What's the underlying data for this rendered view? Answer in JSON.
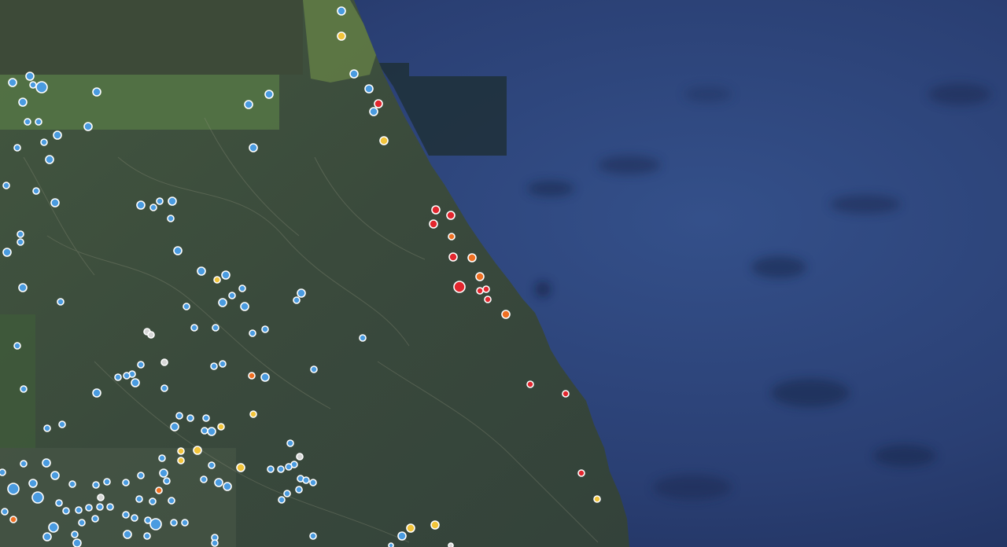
{
  "map": {
    "view": "satellite",
    "layer_colors": {
      "sea": "#2a3f73",
      "sea_deep": "#1d2c56",
      "land": "#3a4a3a",
      "land_light": "#6f8a50",
      "coast_dark": "#1e2c35"
    },
    "category_colors": {
      "blue": "#4a9be0",
      "yellow": "#f2c43a",
      "orange": "#ef6f22",
      "red": "#e2262e",
      "white": "#d6d6d6"
    },
    "markers": [
      {
        "lon": 434,
        "lat": 14,
        "c": "blue",
        "r": 5
      },
      {
        "lon": 434,
        "lat": 46,
        "c": "yellow",
        "r": 5
      },
      {
        "lon": 450,
        "lat": 94,
        "c": "blue",
        "r": 5
      },
      {
        "lon": 469,
        "lat": 113,
        "c": "blue",
        "r": 5
      },
      {
        "lon": 481,
        "lat": 132,
        "c": "red",
        "r": 5
      },
      {
        "lon": 475,
        "lat": 142,
        "c": "blue",
        "r": 5
      },
      {
        "lon": 488,
        "lat": 179,
        "c": "yellow",
        "r": 5
      },
      {
        "lon": 16,
        "lat": 105,
        "c": "blue",
        "r": 5
      },
      {
        "lon": 38,
        "lat": 97,
        "c": "blue",
        "r": 5
      },
      {
        "lon": 42,
        "lat": 108,
        "c": "blue",
        "r": 4
      },
      {
        "lon": 53,
        "lat": 111,
        "c": "blue",
        "r": 7
      },
      {
        "lon": 29,
        "lat": 130,
        "c": "blue",
        "r": 5
      },
      {
        "lon": 35,
        "lat": 155,
        "c": "blue",
        "r": 4
      },
      {
        "lon": 49,
        "lat": 155,
        "c": "blue",
        "r": 4
      },
      {
        "lon": 112,
        "lat": 161,
        "c": "blue",
        "r": 5
      },
      {
        "lon": 123,
        "lat": 117,
        "c": "blue",
        "r": 5
      },
      {
        "lon": 73,
        "lat": 172,
        "c": "blue",
        "r": 5
      },
      {
        "lon": 56,
        "lat": 181,
        "c": "blue",
        "r": 4
      },
      {
        "lon": 22,
        "lat": 188,
        "c": "blue",
        "r": 4
      },
      {
        "lon": 63,
        "lat": 203,
        "c": "blue",
        "r": 5
      },
      {
        "lon": 316,
        "lat": 133,
        "c": "blue",
        "r": 5
      },
      {
        "lon": 342,
        "lat": 120,
        "c": "blue",
        "r": 5
      },
      {
        "lon": 322,
        "lat": 188,
        "c": "blue",
        "r": 5
      },
      {
        "lon": 8,
        "lat": 236,
        "c": "blue",
        "r": 4
      },
      {
        "lon": 46,
        "lat": 243,
        "c": "blue",
        "r": 4
      },
      {
        "lon": 70,
        "lat": 258,
        "c": "blue",
        "r": 5
      },
      {
        "lon": 179,
        "lat": 261,
        "c": "blue",
        "r": 5
      },
      {
        "lon": 195,
        "lat": 264,
        "c": "blue",
        "r": 4
      },
      {
        "lon": 203,
        "lat": 256,
        "c": "blue",
        "r": 4
      },
      {
        "lon": 219,
        "lat": 256,
        "c": "blue",
        "r": 5
      },
      {
        "lon": 217,
        "lat": 278,
        "c": "blue",
        "r": 4
      },
      {
        "lon": 26,
        "lat": 298,
        "c": "blue",
        "r": 4
      },
      {
        "lon": 26,
        "lat": 308,
        "c": "blue",
        "r": 4
      },
      {
        "lon": 9,
        "lat": 321,
        "c": "blue",
        "r": 5
      },
      {
        "lon": 226,
        "lat": 319,
        "c": "blue",
        "r": 5
      },
      {
        "lon": 256,
        "lat": 345,
        "c": "blue",
        "r": 5
      },
      {
        "lon": 287,
        "lat": 350,
        "c": "blue",
        "r": 5
      },
      {
        "lon": 276,
        "lat": 356,
        "c": "yellow",
        "r": 4
      },
      {
        "lon": 308,
        "lat": 367,
        "c": "blue",
        "r": 4
      },
      {
        "lon": 29,
        "lat": 366,
        "c": "blue",
        "r": 5
      },
      {
        "lon": 383,
        "lat": 373,
        "c": "blue",
        "r": 5
      },
      {
        "lon": 377,
        "lat": 382,
        "c": "blue",
        "r": 4
      },
      {
        "lon": 295,
        "lat": 376,
        "c": "blue",
        "r": 4
      },
      {
        "lon": 283,
        "lat": 385,
        "c": "blue",
        "r": 5
      },
      {
        "lon": 311,
        "lat": 390,
        "c": "blue",
        "r": 5
      },
      {
        "lon": 237,
        "lat": 390,
        "c": "blue",
        "r": 4
      },
      {
        "lon": 77,
        "lat": 384,
        "c": "blue",
        "r": 4
      },
      {
        "lon": 247,
        "lat": 417,
        "c": "blue",
        "r": 4
      },
      {
        "lon": 274,
        "lat": 417,
        "c": "blue",
        "r": 4
      },
      {
        "lon": 337,
        "lat": 419,
        "c": "blue",
        "r": 4
      },
      {
        "lon": 321,
        "lat": 424,
        "c": "blue",
        "r": 4
      },
      {
        "lon": 187,
        "lat": 422,
        "c": "white",
        "r": 4
      },
      {
        "lon": 192,
        "lat": 426,
        "c": "white",
        "r": 4
      },
      {
        "lon": 461,
        "lat": 430,
        "c": "blue",
        "r": 4
      },
      {
        "lon": 22,
        "lat": 440,
        "c": "blue",
        "r": 4
      },
      {
        "lon": 209,
        "lat": 461,
        "c": "white",
        "r": 4
      },
      {
        "lon": 179,
        "lat": 464,
        "c": "blue",
        "r": 4
      },
      {
        "lon": 283,
        "lat": 463,
        "c": "blue",
        "r": 4
      },
      {
        "lon": 272,
        "lat": 466,
        "c": "blue",
        "r": 4
      },
      {
        "lon": 399,
        "lat": 470,
        "c": "blue",
        "r": 4
      },
      {
        "lon": 168,
        "lat": 476,
        "c": "blue",
        "r": 4
      },
      {
        "lon": 150,
        "lat": 480,
        "c": "blue",
        "r": 4
      },
      {
        "lon": 161,
        "lat": 478,
        "c": "blue",
        "r": 4
      },
      {
        "lon": 172,
        "lat": 487,
        "c": "blue",
        "r": 5
      },
      {
        "lon": 320,
        "lat": 478,
        "c": "orange",
        "r": 4
      },
      {
        "lon": 337,
        "lat": 480,
        "c": "blue",
        "r": 5
      },
      {
        "lon": 209,
        "lat": 494,
        "c": "blue",
        "r": 4
      },
      {
        "lon": 30,
        "lat": 495,
        "c": "blue",
        "r": 4
      },
      {
        "lon": 123,
        "lat": 500,
        "c": "blue",
        "r": 5
      },
      {
        "lon": 322,
        "lat": 527,
        "c": "yellow",
        "r": 4
      },
      {
        "lon": 228,
        "lat": 529,
        "c": "blue",
        "r": 4
      },
      {
        "lon": 242,
        "lat": 532,
        "c": "blue",
        "r": 4
      },
      {
        "lon": 262,
        "lat": 532,
        "c": "blue",
        "r": 4
      },
      {
        "lon": 222,
        "lat": 543,
        "c": "blue",
        "r": 5
      },
      {
        "lon": 281,
        "lat": 543,
        "c": "yellow",
        "r": 4
      },
      {
        "lon": 260,
        "lat": 548,
        "c": "blue",
        "r": 4
      },
      {
        "lon": 269,
        "lat": 549,
        "c": "blue",
        "r": 5
      },
      {
        "lon": 79,
        "lat": 540,
        "c": "blue",
        "r": 4
      },
      {
        "lon": 60,
        "lat": 545,
        "c": "blue",
        "r": 4
      },
      {
        "lon": 369,
        "lat": 564,
        "c": "blue",
        "r": 4
      },
      {
        "lon": 230,
        "lat": 574,
        "c": "yellow",
        "r": 4
      },
      {
        "lon": 251,
        "lat": 573,
        "c": "yellow",
        "r": 5
      },
      {
        "lon": 230,
        "lat": 586,
        "c": "yellow",
        "r": 4
      },
      {
        "lon": 206,
        "lat": 583,
        "c": "blue",
        "r": 4
      },
      {
        "lon": 381,
        "lat": 581,
        "c": "white",
        "r": 4
      },
      {
        "lon": 374,
        "lat": 591,
        "c": "blue",
        "r": 4
      },
      {
        "lon": 269,
        "lat": 592,
        "c": "blue",
        "r": 4
      },
      {
        "lon": 306,
        "lat": 595,
        "c": "yellow",
        "r": 5
      },
      {
        "lon": 344,
        "lat": 597,
        "c": "blue",
        "r": 4
      },
      {
        "lon": 357,
        "lat": 597,
        "c": "blue",
        "r": 4
      },
      {
        "lon": 367,
        "lat": 594,
        "c": "blue",
        "r": 4
      },
      {
        "lon": 30,
        "lat": 590,
        "c": "blue",
        "r": 4
      },
      {
        "lon": 59,
        "lat": 589,
        "c": "blue",
        "r": 5
      },
      {
        "lon": 3,
        "lat": 601,
        "c": "blue",
        "r": 4
      },
      {
        "lon": 70,
        "lat": 605,
        "c": "blue",
        "r": 5
      },
      {
        "lon": 179,
        "lat": 605,
        "c": "blue",
        "r": 4
      },
      {
        "lon": 208,
        "lat": 602,
        "c": "blue",
        "r": 5
      },
      {
        "lon": 212,
        "lat": 612,
        "c": "blue",
        "r": 4
      },
      {
        "lon": 160,
        "lat": 614,
        "c": "blue",
        "r": 4
      },
      {
        "lon": 136,
        "lat": 613,
        "c": "blue",
        "r": 4
      },
      {
        "lon": 122,
        "lat": 617,
        "c": "blue",
        "r": 4
      },
      {
        "lon": 259,
        "lat": 610,
        "c": "blue",
        "r": 4
      },
      {
        "lon": 278,
        "lat": 614,
        "c": "blue",
        "r": 5
      },
      {
        "lon": 289,
        "lat": 619,
        "c": "blue",
        "r": 5
      },
      {
        "lon": 382,
        "lat": 609,
        "c": "blue",
        "r": 4
      },
      {
        "lon": 389,
        "lat": 611,
        "c": "blue",
        "r": 4
      },
      {
        "lon": 398,
        "lat": 614,
        "c": "blue",
        "r": 4
      },
      {
        "lon": 380,
        "lat": 623,
        "c": "blue",
        "r": 4
      },
      {
        "lon": 365,
        "lat": 628,
        "c": "blue",
        "r": 4
      },
      {
        "lon": 358,
        "lat": 636,
        "c": "blue",
        "r": 4
      },
      {
        "lon": 17,
        "lat": 622,
        "c": "blue",
        "r": 7
      },
      {
        "lon": 42,
        "lat": 615,
        "c": "blue",
        "r": 5
      },
      {
        "lon": 48,
        "lat": 633,
        "c": "blue",
        "r": 7
      },
      {
        "lon": 92,
        "lat": 616,
        "c": "blue",
        "r": 4
      },
      {
        "lon": 202,
        "lat": 624,
        "c": "orange",
        "r": 4
      },
      {
        "lon": 128,
        "lat": 633,
        "c": "white",
        "r": 4
      },
      {
        "lon": 177,
        "lat": 635,
        "c": "blue",
        "r": 4
      },
      {
        "lon": 194,
        "lat": 638,
        "c": "blue",
        "r": 4
      },
      {
        "lon": 218,
        "lat": 637,
        "c": "blue",
        "r": 4
      },
      {
        "lon": 75,
        "lat": 640,
        "c": "blue",
        "r": 4
      },
      {
        "lon": 84,
        "lat": 650,
        "c": "blue",
        "r": 4
      },
      {
        "lon": 6,
        "lat": 651,
        "c": "blue",
        "r": 4
      },
      {
        "lon": 17,
        "lat": 661,
        "c": "orange",
        "r": 4
      },
      {
        "lon": 100,
        "lat": 649,
        "c": "blue",
        "r": 4
      },
      {
        "lon": 113,
        "lat": 646,
        "c": "blue",
        "r": 4
      },
      {
        "lon": 127,
        "lat": 645,
        "c": "blue",
        "r": 4
      },
      {
        "lon": 140,
        "lat": 645,
        "c": "blue",
        "r": 4
      },
      {
        "lon": 160,
        "lat": 655,
        "c": "blue",
        "r": 4
      },
      {
        "lon": 171,
        "lat": 659,
        "c": "blue",
        "r": 4
      },
      {
        "lon": 188,
        "lat": 662,
        "c": "blue",
        "r": 4
      },
      {
        "lon": 198,
        "lat": 667,
        "c": "blue",
        "r": 7
      },
      {
        "lon": 221,
        "lat": 665,
        "c": "blue",
        "r": 4
      },
      {
        "lon": 235,
        "lat": 665,
        "c": "blue",
        "r": 4
      },
      {
        "lon": 68,
        "lat": 671,
        "c": "blue",
        "r": 6
      },
      {
        "lon": 104,
        "lat": 665,
        "c": "blue",
        "r": 4
      },
      {
        "lon": 121,
        "lat": 660,
        "c": "blue",
        "r": 4
      },
      {
        "lon": 95,
        "lat": 680,
        "c": "blue",
        "r": 4
      },
      {
        "lon": 60,
        "lat": 683,
        "c": "blue",
        "r": 5
      },
      {
        "lon": 162,
        "lat": 680,
        "c": "blue",
        "r": 5
      },
      {
        "lon": 187,
        "lat": 682,
        "c": "blue",
        "r": 4
      },
      {
        "lon": 273,
        "lat": 684,
        "c": "blue",
        "r": 4
      },
      {
        "lon": 273,
        "lat": 691,
        "c": "blue",
        "r": 4
      },
      {
        "lon": 98,
        "lat": 691,
        "c": "blue",
        "r": 5
      },
      {
        "lon": 511,
        "lat": 682,
        "c": "blue",
        "r": 5
      },
      {
        "lon": 522,
        "lat": 672,
        "c": "yellow",
        "r": 5
      },
      {
        "lon": 553,
        "lat": 668,
        "c": "yellow",
        "r": 5
      },
      {
        "lon": 398,
        "lat": 682,
        "c": "blue",
        "r": 4
      },
      {
        "lon": 497,
        "lat": 694,
        "c": "blue",
        "r": 3
      },
      {
        "lon": 573,
        "lat": 694,
        "c": "white",
        "r": 3
      },
      {
        "lon": 554,
        "lat": 267,
        "c": "red",
        "r": 5
      },
      {
        "lon": 573,
        "lat": 274,
        "c": "red",
        "r": 5
      },
      {
        "lon": 551,
        "lat": 285,
        "c": "red",
        "r": 5
      },
      {
        "lon": 574,
        "lat": 301,
        "c": "orange",
        "r": 4
      },
      {
        "lon": 576,
        "lat": 327,
        "c": "red",
        "r": 5
      },
      {
        "lon": 600,
        "lat": 328,
        "c": "orange",
        "r": 5
      },
      {
        "lon": 610,
        "lat": 352,
        "c": "orange",
        "r": 5
      },
      {
        "lon": 584,
        "lat": 365,
        "c": "red",
        "r": 7
      },
      {
        "lon": 618,
        "lat": 368,
        "c": "red",
        "r": 4
      },
      {
        "lon": 610,
        "lat": 370,
        "c": "red",
        "r": 4
      },
      {
        "lon": 620,
        "lat": 381,
        "c": "red",
        "r": 4
      },
      {
        "lon": 643,
        "lat": 400,
        "c": "orange",
        "r": 5
      },
      {
        "lon": 674,
        "lat": 489,
        "c": "red",
        "r": 4
      },
      {
        "lon": 719,
        "lat": 501,
        "c": "red",
        "r": 4
      },
      {
        "lon": 739,
        "lat": 602,
        "c": "red",
        "r": 4
      },
      {
        "lon": 759,
        "lat": 635,
        "c": "yellow",
        "r": 4
      }
    ]
  }
}
